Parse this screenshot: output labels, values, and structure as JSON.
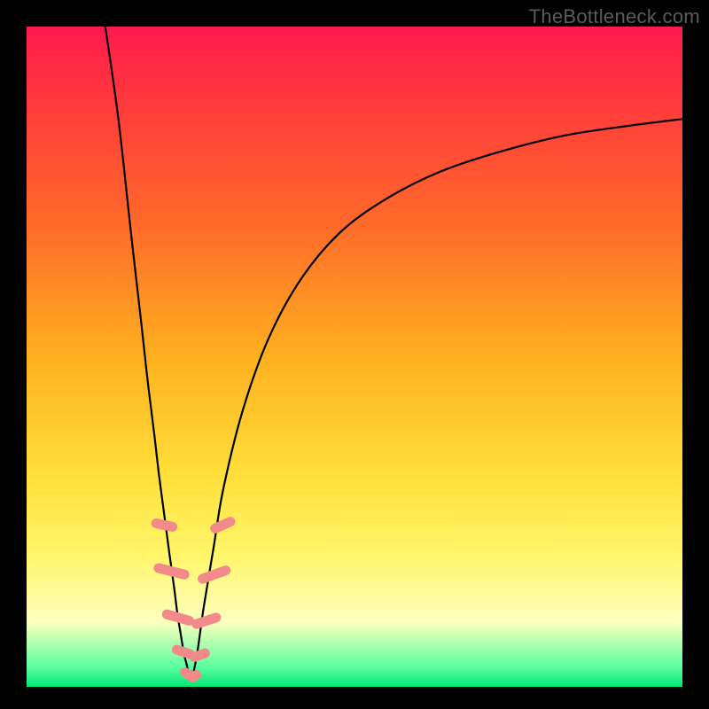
{
  "watermark": "TheBottleneck.com",
  "colors": {
    "frame": "#000000",
    "gradient_top": "#ff1a4d",
    "gradient_bottom": "#00e676",
    "curve": "#000000",
    "bead": "#f28a8a"
  },
  "chart_data": {
    "type": "line",
    "title": "",
    "xlabel": "",
    "ylabel": "",
    "xlim": [
      0,
      100
    ],
    "ylim": [
      0,
      100
    ],
    "note": "No axis ticks or numeric labels are rendered; values are estimated from pixel positions on a 0–100 normalized scale. y ≈ distance from bottom (green) edge, so 0 is bottom.",
    "series": [
      {
        "name": "left-curve",
        "x": [
          12,
          14,
          16,
          17.5,
          18.5,
          19.5,
          20.2,
          21,
          21.8,
          22.5,
          23,
          23.5,
          24,
          24.5,
          24.8
        ],
        "y": [
          100,
          86,
          68,
          55,
          46,
          38,
          32,
          26,
          20,
          15,
          11,
          8,
          5,
          3,
          1
        ]
      },
      {
        "name": "right-curve",
        "x": [
          25.2,
          26,
          27,
          28.5,
          30,
          33,
          37,
          42,
          48,
          55,
          63,
          72,
          82,
          92,
          100
        ],
        "y": [
          1,
          5,
          12,
          21,
          30,
          42,
          53,
          62,
          69,
          74,
          78,
          81,
          83.5,
          85,
          86
        ]
      }
    ],
    "markers": {
      "name": "beads",
      "shape": "capsule",
      "color": "#f28a8a",
      "points": [
        {
          "x": 21.0,
          "y": 24.5,
          "len": 4.0,
          "angle": -78
        },
        {
          "x": 22.1,
          "y": 17.5,
          "len": 5.5,
          "angle": -76
        },
        {
          "x": 23.1,
          "y": 10.5,
          "len": 5.0,
          "angle": -74
        },
        {
          "x": 23.9,
          "y": 5.3,
          "len": 3.6,
          "angle": -72
        },
        {
          "x": 24.5,
          "y": 2.0,
          "len": 2.4,
          "angle": -60
        },
        {
          "x": 25.6,
          "y": 1.6,
          "len": 2.2,
          "angle": 55
        },
        {
          "x": 26.4,
          "y": 4.8,
          "len": 3.2,
          "angle": 70
        },
        {
          "x": 27.4,
          "y": 10.0,
          "len": 4.6,
          "angle": 72
        },
        {
          "x": 28.6,
          "y": 17.0,
          "len": 5.2,
          "angle": 70
        },
        {
          "x": 29.9,
          "y": 24.5,
          "len": 4.0,
          "angle": 66
        }
      ]
    }
  }
}
